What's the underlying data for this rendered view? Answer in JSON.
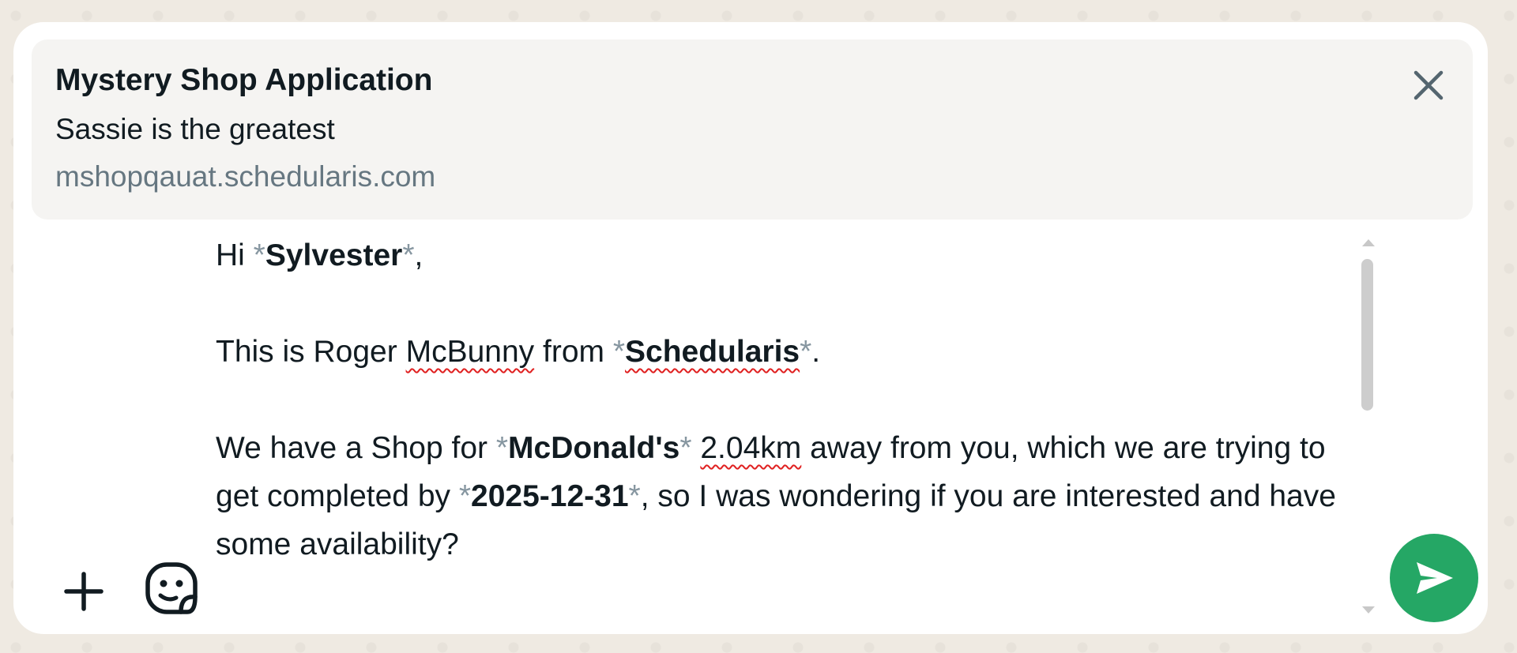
{
  "link_preview": {
    "title": "Mystery Shop Application",
    "description": "Sassie is the greatest",
    "url": "mshopqauat.schedularis.com"
  },
  "message": {
    "greeting_prefix": "Hi ",
    "greeting_name": "Sylvester",
    "greeting_suffix": ",",
    "intro_prefix": "This is Roger ",
    "intro_person": "McBunny",
    "intro_from": " from ",
    "intro_company": "Schedularis",
    "intro_suffix": ".",
    "shop_prefix": "We have a Shop for ",
    "shop_name": "McDonald's",
    "shop_space": " ",
    "shop_distance": "2.04km",
    "shop_mid": " away from you, which we are trying to get completed by ",
    "shop_date": "2025-12-31",
    "shop_suffix": ", so I was wondering if you are interested and have some availability?",
    "markdown_marker": "*"
  },
  "icons": {
    "close": "close-icon",
    "attach": "plus-icon",
    "sticker": "sticker-icon",
    "send": "send-icon"
  },
  "colors": {
    "send_button": "#25a765",
    "background": "#efeae2",
    "spellcheck": "#e02020"
  }
}
